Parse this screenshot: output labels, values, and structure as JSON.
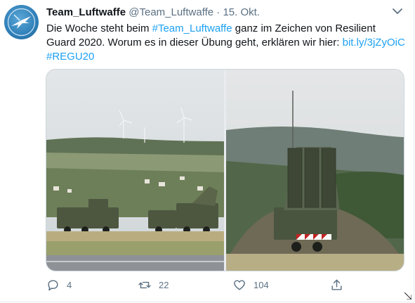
{
  "tweet": {
    "display_name": "Team_Luftwaffe",
    "handle": "@Team_Luftwaffe",
    "separator": "·",
    "date": "15. Okt.",
    "text_part1": "Die Woche steht beim ",
    "hashtag1": "#Team_Luftwaffe",
    "text_part2": " ganz im Zeichen von Resilient Guard 2020. Worum es in dieser Übung geht, erklären wir hier: ",
    "link": "bit.ly/3jZyOiC",
    "hashtag2": "#REGU20"
  },
  "actions": {
    "replies": "4",
    "retweets": "22",
    "likes": "104"
  },
  "icons": {
    "avatar": "luftwaffe-logo",
    "menu": "chevron-down-icon",
    "reply": "reply-icon",
    "retweet": "retweet-icon",
    "like": "heart-icon",
    "share": "share-icon"
  },
  "colors": {
    "link": "#1da1f2",
    "muted": "#5b7083",
    "text": "#0f1419"
  }
}
